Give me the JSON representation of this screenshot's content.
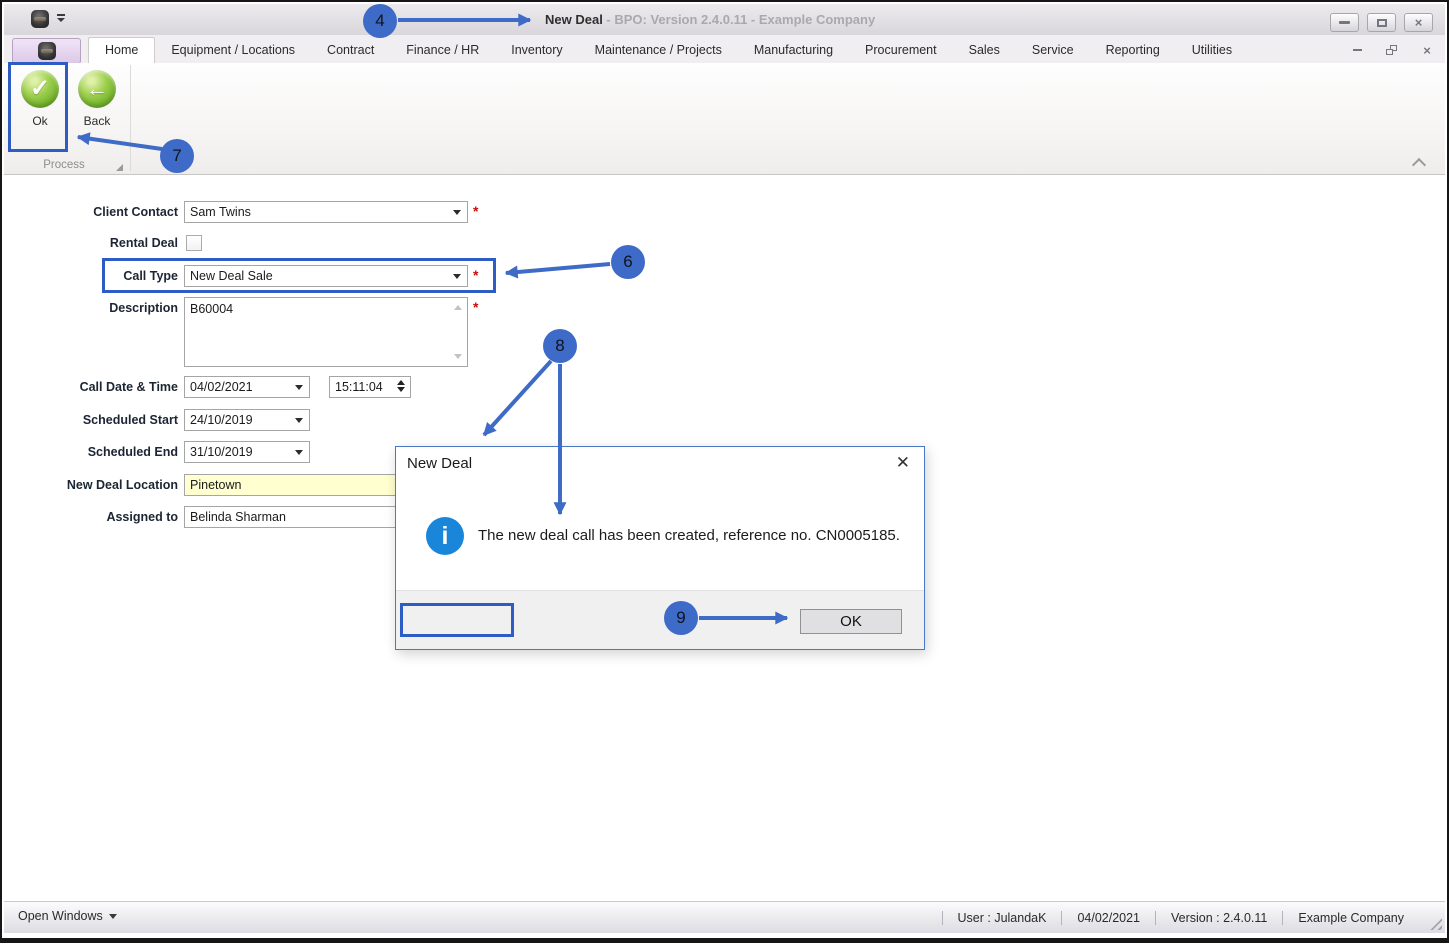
{
  "titlebar": {
    "title_primary": "New Deal",
    "title_secondary": " - BPO: Version 2.4.0.11 - Example Company"
  },
  "tabs": [
    "Home",
    "Equipment / Locations",
    "Contract",
    "Finance / HR",
    "Inventory",
    "Maintenance / Projects",
    "Manufacturing",
    "Procurement",
    "Sales",
    "Service",
    "Reporting",
    "Utilities"
  ],
  "ribbon": {
    "ok": "Ok",
    "back": "Back",
    "group": "Process"
  },
  "form": {
    "required_marker": "*",
    "client_contact": {
      "label": "Client Contact",
      "value": "Sam Twins"
    },
    "rental_deal": {
      "label": "Rental Deal",
      "checked": false
    },
    "call_type": {
      "label": "Call Type",
      "value": "New Deal Sale"
    },
    "description": {
      "label": "Description",
      "value": "B60004"
    },
    "call_date_time": {
      "label": "Call Date & Time",
      "date": "04/02/2021",
      "time": "15:11:04"
    },
    "scheduled_start": {
      "label": "Scheduled Start",
      "value": "24/10/2019"
    },
    "scheduled_end": {
      "label": "Scheduled End",
      "value": "31/10/2019"
    },
    "new_deal_location": {
      "label": "New Deal Location",
      "value": "Pinetown"
    },
    "assigned_to": {
      "label": "Assigned to",
      "value": "Belinda Sharman"
    }
  },
  "dialog": {
    "title": "New Deal",
    "message": "The new deal call has been created, reference no. CN0005185.",
    "ok": "OK"
  },
  "statusbar": {
    "open_windows": "Open Windows",
    "user": "User : JulandaK",
    "date": "04/02/2021",
    "version": "Version : 2.4.0.11",
    "company": "Example Company"
  },
  "annotations": {
    "step4": "4",
    "step6": "6",
    "step7": "7",
    "step8": "8",
    "step9": "9"
  },
  "colors": {
    "annotation_blue": "#3d6bc6",
    "highlight_blue": "#2d5cc5",
    "info_blue": "#1a86d9",
    "button_green": "#74b42c",
    "required_red": "#cf0a0a",
    "location_field_yellow": "#ffffcf"
  }
}
